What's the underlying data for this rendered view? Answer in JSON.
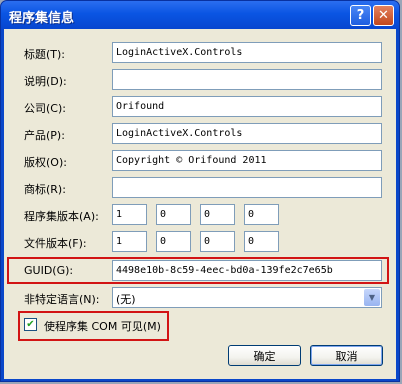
{
  "window": {
    "title": "程序集信息",
    "help_glyph": "?",
    "close_glyph": "✕"
  },
  "fields": [
    {
      "label": "标题(T):",
      "value": "LoginActiveX.Controls"
    },
    {
      "label": "说明(D):",
      "value": ""
    },
    {
      "label": "公司(C):",
      "value": "Orifound"
    },
    {
      "label": "产品(P):",
      "value": "LoginActiveX.Controls"
    },
    {
      "label": "版权(O):",
      "value": "Copyright © Orifound 2011"
    },
    {
      "label": "商标(R):",
      "value": ""
    }
  ],
  "assembly_version": {
    "label": "程序集版本(A):",
    "parts": [
      "1",
      "0",
      "0",
      "0"
    ]
  },
  "file_version": {
    "label": "文件版本(F):",
    "parts": [
      "1",
      "0",
      "0",
      "0"
    ]
  },
  "guid": {
    "label": "GUID(G):",
    "value": "4498e10b-8c59-4eec-bd0a-139fe2c7e65b"
  },
  "neutral_language": {
    "label": "非特定语言(N):",
    "selected": "(无)"
  },
  "com_visible": {
    "label": "使程序集 COM 可见(M)",
    "checked": true
  },
  "buttons": {
    "ok": "确定",
    "cancel": "取消"
  },
  "colors": {
    "highlight_red": "#d21414",
    "title_blue": "#0a55e3"
  }
}
